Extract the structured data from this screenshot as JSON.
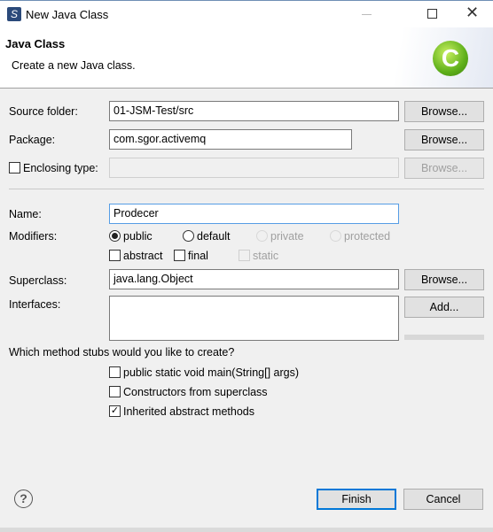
{
  "window": {
    "title": "New Java Class"
  },
  "header": {
    "title": "Java Class",
    "description": "Create a new Java class."
  },
  "form": {
    "source_folder": {
      "label": "Source folder:",
      "value": "01-JSM-Test/src",
      "browse": "Browse..."
    },
    "package": {
      "label": "Package:",
      "value": "com.sgor.activemq",
      "browse": "Browse..."
    },
    "enclosing": {
      "label": "Enclosing type:",
      "value": "",
      "browse": "Browse...",
      "checked": false
    },
    "name": {
      "label": "Name:",
      "value": "Prodecer"
    },
    "modifiers": {
      "label": "Modifiers:",
      "public": "public",
      "default": "default",
      "private": "private",
      "protected": "protected",
      "selected": "public",
      "abstract": "abstract",
      "final": "final",
      "static": "static"
    },
    "superclass": {
      "label": "Superclass:",
      "value": "java.lang.Object",
      "browse": "Browse..."
    },
    "interfaces": {
      "label": "Interfaces:",
      "add": "Add..."
    },
    "stubs": {
      "question": "Which method stubs would you like to create?",
      "main": "public static void main(String[] args)",
      "constructors": "Constructors from superclass",
      "inherited": "Inherited abstract methods",
      "main_checked": false,
      "constructors_checked": false,
      "inherited_checked": true
    }
  },
  "footer": {
    "help": "?",
    "finish": "Finish",
    "cancel": "Cancel"
  }
}
